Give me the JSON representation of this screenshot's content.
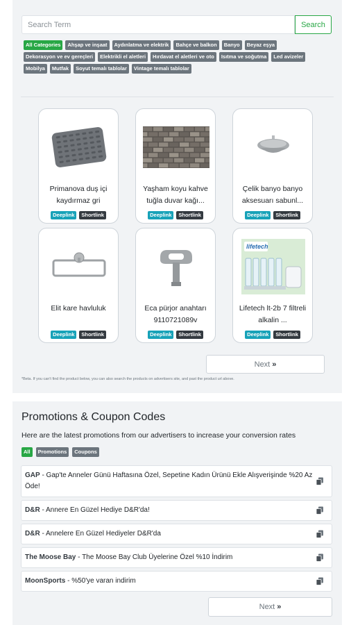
{
  "search": {
    "placeholder": "Search Term",
    "button_label": "Search"
  },
  "categories": [
    {
      "label": "All Categories",
      "active": true
    },
    {
      "label": "Ahşap ve inşaat"
    },
    {
      "label": "Aydınlatma ve elektrik"
    },
    {
      "label": "Bahçe ve balkon"
    },
    {
      "label": "Banyo"
    },
    {
      "label": "Beyaz eşya"
    },
    {
      "label": "Dekorasyon ve ev gereçleri"
    },
    {
      "label": "Elektrikli el aletleri"
    },
    {
      "label": "Hırdavat el aletleri ve oto"
    },
    {
      "label": "Isıtma ve soğutma"
    },
    {
      "label": "Led avizeler"
    },
    {
      "label": "Mobilya"
    },
    {
      "label": "Mutfak"
    },
    {
      "label": "Soyut temalı tablolar"
    },
    {
      "label": "Vintage temalı tablolar"
    }
  ],
  "products": [
    {
      "title": "Primanova duş içi kaydırmaz gri",
      "image_icon": "shower-mat-icon"
    },
    {
      "title": "Yaşham koyu kahve tuğla duvar kağı...",
      "image_icon": "brick-wallpaper-icon"
    },
    {
      "title": "Çelik banyo banyo aksesuarı sabunl...",
      "image_icon": "soap-dish-icon"
    },
    {
      "title": "Elit kare havluluk",
      "image_icon": "towel-rail-icon"
    },
    {
      "title": "Eca pürjor anahtarı 9110721089v",
      "image_icon": "radiator-key-icon"
    },
    {
      "title": "Lifetech lt-2b 7 filtreli alkalin ...",
      "image_icon": "water-filter-icon"
    }
  ],
  "product_links": {
    "deeplink": "Deeplink",
    "shortlink": "Shortlink"
  },
  "pagination": {
    "next_label": "Next"
  },
  "beta_note": "*Beta. If you can't find the product below, you can also search the products on advertisers site, and past the product url above.",
  "promotions": {
    "title": "Promotions & Coupon Codes",
    "subtitle": "Here are the latest promotions from our advertisers to increase your conversion rates",
    "filters": [
      {
        "label": "All",
        "active": true
      },
      {
        "label": "Promotions"
      },
      {
        "label": "Coupons"
      }
    ],
    "items": [
      {
        "advertiser": "GAP",
        "text": " - Gap'te Anneler Günü Haftasına Özel, Sepetine Kadın Ürünü Ekle Alışverişinde %20 Az Öde!"
      },
      {
        "advertiser": "D&R",
        "text": " - Annere En Güzel Hediye D&R'da!"
      },
      {
        "advertiser": "D&R",
        "text": " - Annelere En Güzel Hediyeler D&R'da"
      },
      {
        "advertiser": "The Moose Bay",
        "text": " - The Moose Bay Club Üyelerine Özel %10 İndirim"
      },
      {
        "advertiser": "MoonSports",
        "text": " - %50'ye varan indirim"
      }
    ],
    "next_label": "Next"
  },
  "colors": {
    "green": "#28a745",
    "gray_badge": "#6c757d",
    "cyan": "#17a2b8",
    "dark": "#343a40"
  }
}
